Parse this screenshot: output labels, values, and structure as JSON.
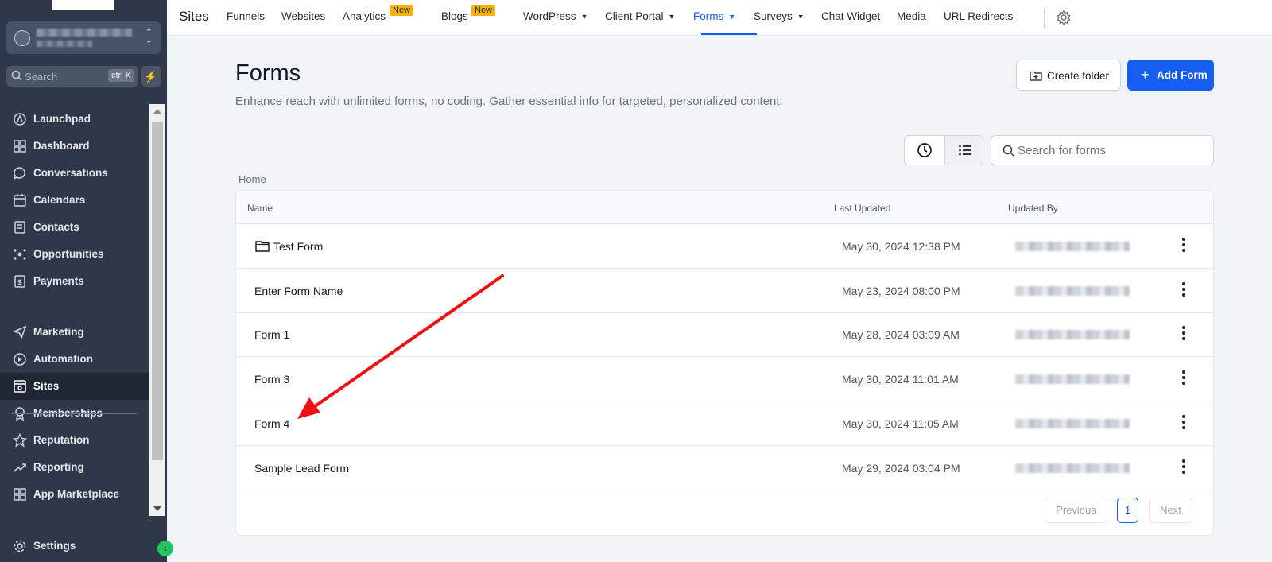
{
  "sidebar": {
    "search_placeholder": "Search",
    "search_shortcut": "ctrl K",
    "items": [
      {
        "label": "Launchpad",
        "icon": "launchpad-icon"
      },
      {
        "label": "Dashboard",
        "icon": "dashboard-icon"
      },
      {
        "label": "Conversations",
        "icon": "chat-bubble-icon"
      },
      {
        "label": "Calendars",
        "icon": "calendar-icon"
      },
      {
        "label": "Contacts",
        "icon": "contacts-icon"
      },
      {
        "label": "Opportunities",
        "icon": "opportunities-icon"
      },
      {
        "label": "Payments",
        "icon": "payments-icon"
      },
      {
        "label": "Marketing",
        "icon": "send-icon"
      },
      {
        "label": "Automation",
        "icon": "automation-icon"
      },
      {
        "label": "Sites",
        "icon": "sites-icon",
        "active": true
      },
      {
        "label": "Memberships",
        "icon": "badge-icon"
      },
      {
        "label": "Reputation",
        "icon": "star-icon"
      },
      {
        "label": "Reporting",
        "icon": "trend-icon"
      },
      {
        "label": "App Marketplace",
        "icon": "grid-icon"
      }
    ],
    "settings_label": "Settings"
  },
  "topbar": {
    "title": "Sites",
    "tabs": [
      {
        "label": "Funnels"
      },
      {
        "label": "Websites"
      },
      {
        "label": "Analytics",
        "badge": "New"
      },
      {
        "label": "Blogs",
        "badge": "New"
      },
      {
        "label": "WordPress",
        "dropdown": true
      },
      {
        "label": "Client Portal",
        "dropdown": true
      },
      {
        "label": "Forms",
        "dropdown": true,
        "active": true
      },
      {
        "label": "Surveys",
        "dropdown": true
      },
      {
        "label": "Chat Widget"
      },
      {
        "label": "Media"
      },
      {
        "label": "URL Redirects"
      }
    ]
  },
  "page": {
    "title": "Forms",
    "subtitle": "Enhance reach with unlimited forms, no coding. Gather essential info for targeted, personalized content.",
    "create_folder_label": "Create folder",
    "add_form_label": "Add Form",
    "search_placeholder": "Search for forms",
    "breadcrumb": "Home"
  },
  "table": {
    "columns": [
      "Name",
      "Last Updated",
      "Updated By"
    ],
    "rows": [
      {
        "name": "Test Form",
        "type": "folder",
        "last_updated": "May 30, 2024 12:38 PM"
      },
      {
        "name": "Enter Form Name",
        "type": "form",
        "last_updated": "May 23, 2024 08:00 PM"
      },
      {
        "name": "Form 1",
        "type": "form",
        "last_updated": "May 28, 2024 03:09 AM"
      },
      {
        "name": "Form 3",
        "type": "form",
        "last_updated": "May 30, 2024 11:01 AM"
      },
      {
        "name": "Form 4",
        "type": "form",
        "last_updated": "May 30, 2024 11:05 AM"
      },
      {
        "name": "Sample Lead Form",
        "type": "form",
        "last_updated": "May 29, 2024 03:04 PM"
      }
    ]
  },
  "pagination": {
    "previous": "Previous",
    "current": "1",
    "next": "Next"
  },
  "colors": {
    "accent": "#155eef",
    "sidebar": "#2e3849",
    "badge": "#f5b40b",
    "annotation_arrow": "#ef1111"
  }
}
